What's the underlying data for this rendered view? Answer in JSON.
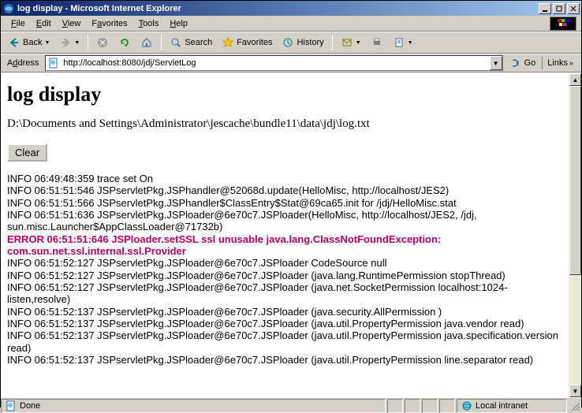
{
  "window": {
    "title": "log display - Microsoft Internet Explorer"
  },
  "menu": {
    "file": "File",
    "edit": "Edit",
    "view": "View",
    "favorites": "Favorites",
    "tools": "Tools",
    "help": "Help"
  },
  "toolbar": {
    "back": "Back",
    "search": "Search",
    "favorites": "Favorites",
    "history": "History"
  },
  "address": {
    "label": "Address",
    "url": "http://localhost:8080/jdj/ServletLog",
    "go": "Go",
    "links": "Links"
  },
  "page": {
    "heading": "log display",
    "path": "D:\\Documents and Settings\\Administrator\\jescache\\bundle11\\data\\jdj\\log.txt",
    "clear": "Clear",
    "lines": [
      {
        "t": "INFO 06:49:48:359 trace set On",
        "err": false
      },
      {
        "t": "INFO 06:51:51:546 JSPservletPkg.JSPhandler@52068d.update(HelloMisc, http://localhost/JES2)",
        "err": false
      },
      {
        "t": "INFO 06:51:51:566 JSPservletPkg.JSPhandler$ClassEntry$Stat@69ca65.init for /jdj/HelloMisc.stat",
        "err": false
      },
      {
        "t": "INFO 06:51:51:636 JSPservletPkg.JSPloader@6e70c7.JSPloader(HelloMisc, http://localhost/JES2, /jdj, sun.misc.Launcher$AppClassLoader@71732b)",
        "err": false
      },
      {
        "t": "ERROR 06:51:51:646 JSPloader.setSSL ssl unusable java.lang.ClassNotFoundException: com.sun.net.ssl.internal.ssl.Provider",
        "err": true
      },
      {
        "t": "INFO 06:51:52:127 JSPservletPkg.JSPloader@6e70c7.JSPloader CodeSource null",
        "err": false
      },
      {
        "t": "INFO 06:51:52:127 JSPservletPkg.JSPloader@6e70c7.JSPloader (java.lang.RuntimePermission stopThread)",
        "err": false
      },
      {
        "t": "INFO 06:51:52:127 JSPservletPkg.JSPloader@6e70c7.JSPloader (java.net.SocketPermission localhost:1024- listen,resolve)",
        "err": false
      },
      {
        "t": "INFO 06:51:52:137 JSPservletPkg.JSPloader@6e70c7.JSPloader (java.security.AllPermission )",
        "err": false
      },
      {
        "t": "INFO 06:51:52:137 JSPservletPkg.JSPloader@6e70c7.JSPloader (java.util.PropertyPermission java.vendor read)",
        "err": false
      },
      {
        "t": "INFO 06:51:52:137 JSPservletPkg.JSPloader@6e70c7.JSPloader (java.util.PropertyPermission java.specification.version read)",
        "err": false
      },
      {
        "t": "INFO 06:51:52:137 JSPservletPkg.JSPloader@6e70c7.JSPloader (java.util.PropertyPermission line.separator read)",
        "err": false
      }
    ]
  },
  "status": {
    "done": "Done",
    "zone": "Local intranet"
  }
}
